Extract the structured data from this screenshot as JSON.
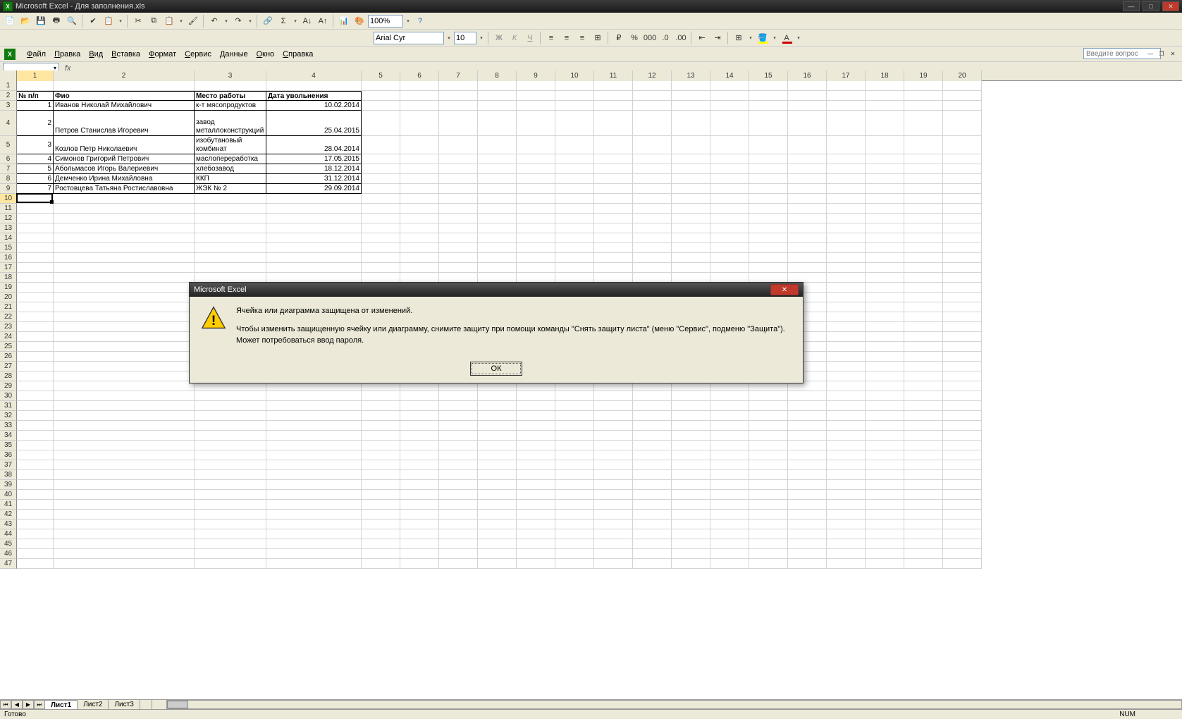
{
  "titlebar": {
    "title": "Microsoft Excel - Для заполнения.xls"
  },
  "toolbar1": {
    "zoom": "100%"
  },
  "toolbar2": {
    "font": "Arial Cyr",
    "size": "10"
  },
  "menu": {
    "items": [
      "Файл",
      "Правка",
      "Вид",
      "Вставка",
      "Формат",
      "Сервис",
      "Данные",
      "Окно",
      "Справка"
    ],
    "ask_placeholder": "Введите вопрос"
  },
  "formula": {
    "name_box": "",
    "fx": "fx"
  },
  "columns": {
    "widths": [
      52,
      200,
      102,
      135,
      55,
      55,
      55,
      55,
      55,
      55,
      55,
      55,
      55,
      55,
      55,
      55,
      55,
      55,
      55,
      55
    ],
    "labels": [
      "1",
      "2",
      "3",
      "4",
      "5",
      "6",
      "7",
      "8",
      "9",
      "10",
      "11",
      "12",
      "13",
      "14",
      "15",
      "16",
      "17",
      "18",
      "19",
      "20"
    ]
  },
  "table": {
    "headers": [
      "№ п/п",
      "Фио",
      "Место работы",
      "Дата увольнения"
    ],
    "rows": [
      {
        "n": "1",
        "fio": "Иванов Николай Михайлович",
        "work": "к-т мясопродуктов",
        "date": "10.02.2014",
        "h": 14
      },
      {
        "n": "2",
        "fio": "Петров Станислав Игоревич",
        "work": "завод металлоконструкций",
        "date": "25.04.2015",
        "h": 36
      },
      {
        "n": "3",
        "fio": "Козлов Петр Николаевич",
        "work": "изобутановый комбинат",
        "date": "28.04.2014",
        "h": 26
      },
      {
        "n": "4",
        "fio": "Симонов Григорий Петрович",
        "work": "маслопереработка",
        "date": "17.05.2015",
        "h": 14
      },
      {
        "n": "5",
        "fio": "Абольмасов Игорь Валериевич",
        "work": "хлебозавод",
        "date": "18.12.2014",
        "h": 14
      },
      {
        "n": "6",
        "fio": "Демченко Ирина Михайловна",
        "work": "ККП",
        "date": "31.12.2014",
        "h": 14
      },
      {
        "n": "7",
        "fio": "Ростовцева Татьяна Ростиславовна",
        "work": "ЖЭК № 2",
        "date": "29.09.2014",
        "h": 14
      }
    ]
  },
  "active_cell": {
    "row": 10,
    "col": 1
  },
  "sheet_tabs": {
    "tabs": [
      "Лист1",
      "Лист2",
      "Лист3"
    ],
    "active": 0
  },
  "statusbar": {
    "left": "Готово",
    "right": "NUM"
  },
  "dialog": {
    "title": "Microsoft Excel",
    "line1": "Ячейка или диаграмма защищена от изменений.",
    "line2": "Чтобы изменить защищенную ячейку или диаграмму, снимите защиту при помощи команды \"Снять защиту листа\" (меню \"Сервис\", подменю \"Защита\"). Может потребоваться ввод пароля.",
    "ok": "ОК"
  }
}
